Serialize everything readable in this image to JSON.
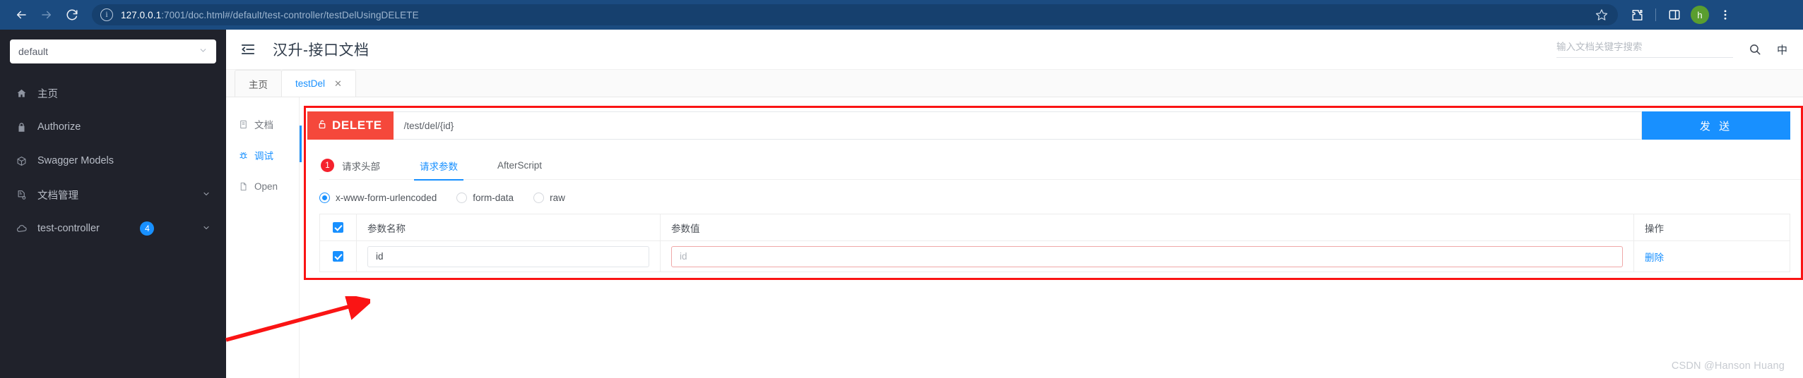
{
  "browser": {
    "back_icon": "arrow-left-icon",
    "forward_icon": "arrow-right-icon",
    "reload_icon": "reload-icon",
    "info_icon": "site-info-icon",
    "url_host": "127.0.0.1",
    "url_rest": ":7001/doc.html#/default/test-controller/testDelUsingDELETE",
    "url_full": "127.0.0.1:7001/doc.html#/default/test-controller/testDelUsingDELETE",
    "bookmark_icon": "star-icon",
    "extensions_icon": "puzzle-icon",
    "sidepanel_icon": "side-panel-icon",
    "avatar_letter": "h",
    "menu_icon": "three-dots-icon",
    "chrome_bg": "#1b4b80"
  },
  "sidebar": {
    "env_value": "default",
    "env_chevron_icon": "chevron-down-icon",
    "items": [
      {
        "label": "主页",
        "icon": "home-icon",
        "badge": null,
        "chevron": false
      },
      {
        "label": "Authorize",
        "icon": "lock-icon",
        "badge": null,
        "chevron": false
      },
      {
        "label": "Swagger Models",
        "icon": "cube-icon",
        "badge": null,
        "chevron": false
      },
      {
        "label": "文档管理",
        "icon": "doc-gear-icon",
        "badge": null,
        "chevron": true
      },
      {
        "label": "test-controller",
        "icon": "cloud-icon",
        "badge": "4",
        "chevron": true
      }
    ]
  },
  "header": {
    "collapse_icon": "collapse-menu-icon",
    "title": "汉升-接口文档",
    "search_placeholder": "输入文档关键字搜索",
    "search_value": "",
    "search_icon": "search-icon",
    "lang_toggle": "中"
  },
  "doc_tabs": [
    {
      "label": "主页",
      "active": false,
      "closable": false
    },
    {
      "label": "testDel",
      "active": true,
      "closable": true,
      "close_icon": "close-icon"
    }
  ],
  "inner_nav": [
    {
      "label": "文档",
      "icon": "document-icon",
      "active": false
    },
    {
      "label": "调试",
      "icon": "bug-icon",
      "active": true
    },
    {
      "label": "Open",
      "icon": "file-icon",
      "active": false
    }
  ],
  "request": {
    "method": "DELETE",
    "method_icon": "unlock-icon",
    "method_color": "#f5483b",
    "url": "/test/del/{id}",
    "send_label": "发 送",
    "send_color": "#1890ff",
    "tabs": [
      {
        "label": "请求头部",
        "badge": "1",
        "active": false
      },
      {
        "label": "请求参数",
        "badge": null,
        "active": true
      },
      {
        "label": "AfterScript",
        "badge": null,
        "active": false
      }
    ],
    "body_types": [
      {
        "label": "x-www-form-urlencoded",
        "checked": true
      },
      {
        "label": "form-data",
        "checked": false
      },
      {
        "label": "raw",
        "checked": false
      }
    ],
    "table": {
      "select_all_checked": true,
      "headers": [
        "参数名称",
        "参数值",
        "操作"
      ],
      "rows": [
        {
          "checked": true,
          "name_value": "id",
          "name_placeholder": "",
          "value_value": "",
          "value_placeholder": "id",
          "value_error": true,
          "action_label": "删除"
        }
      ]
    }
  },
  "annotation": {
    "box_color": "#fa1414",
    "arrow_icon": "red-arrow-icon"
  },
  "watermark": "CSDN @Hanson Huang"
}
